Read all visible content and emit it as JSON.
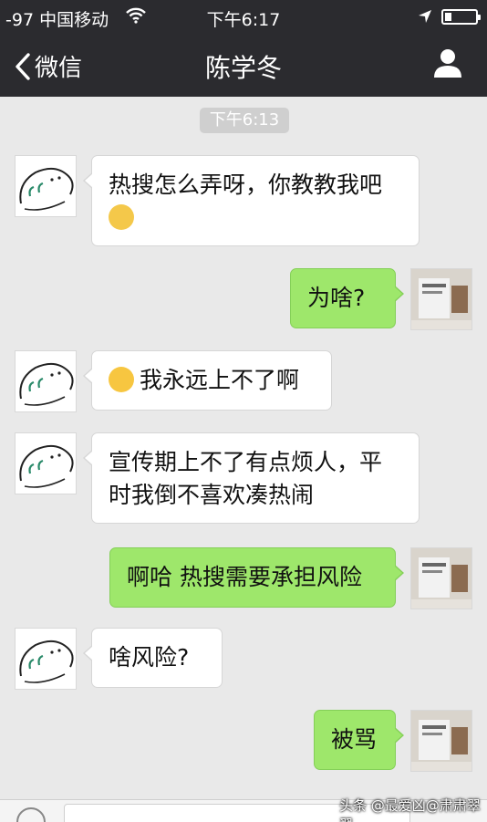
{
  "status_bar": {
    "signal": "-97 中国移动",
    "time": "下午6:17"
  },
  "nav": {
    "back_label": "微信",
    "title": "陈学冬"
  },
  "chat": {
    "timestamp": "下午6:13",
    "messages": [
      {
        "side": "left",
        "line1": "热搜怎么弄呀，你教教我吧",
        "emoji": "crying-emoji"
      },
      {
        "side": "right",
        "text": "为啥?"
      },
      {
        "side": "left",
        "text": "我永远上不了啊",
        "emoji": "tears-of-joy-emoji"
      },
      {
        "side": "left",
        "line1": "宣传期上不了有点烦人，平",
        "line2": "时我倒不喜欢凑热闹"
      },
      {
        "side": "right",
        "text": "啊哈 热搜需要承担风险"
      },
      {
        "side": "left",
        "text": "啥风险?"
      },
      {
        "side": "right",
        "text": "被骂"
      }
    ]
  },
  "watermark": "头条 @最爱凶@肃肃翠翠",
  "colors": {
    "bar": "#2b2b2f",
    "background": "#e9e9e9",
    "sent_bubble": "#9ee76b",
    "received_bubble": "#ffffff"
  }
}
